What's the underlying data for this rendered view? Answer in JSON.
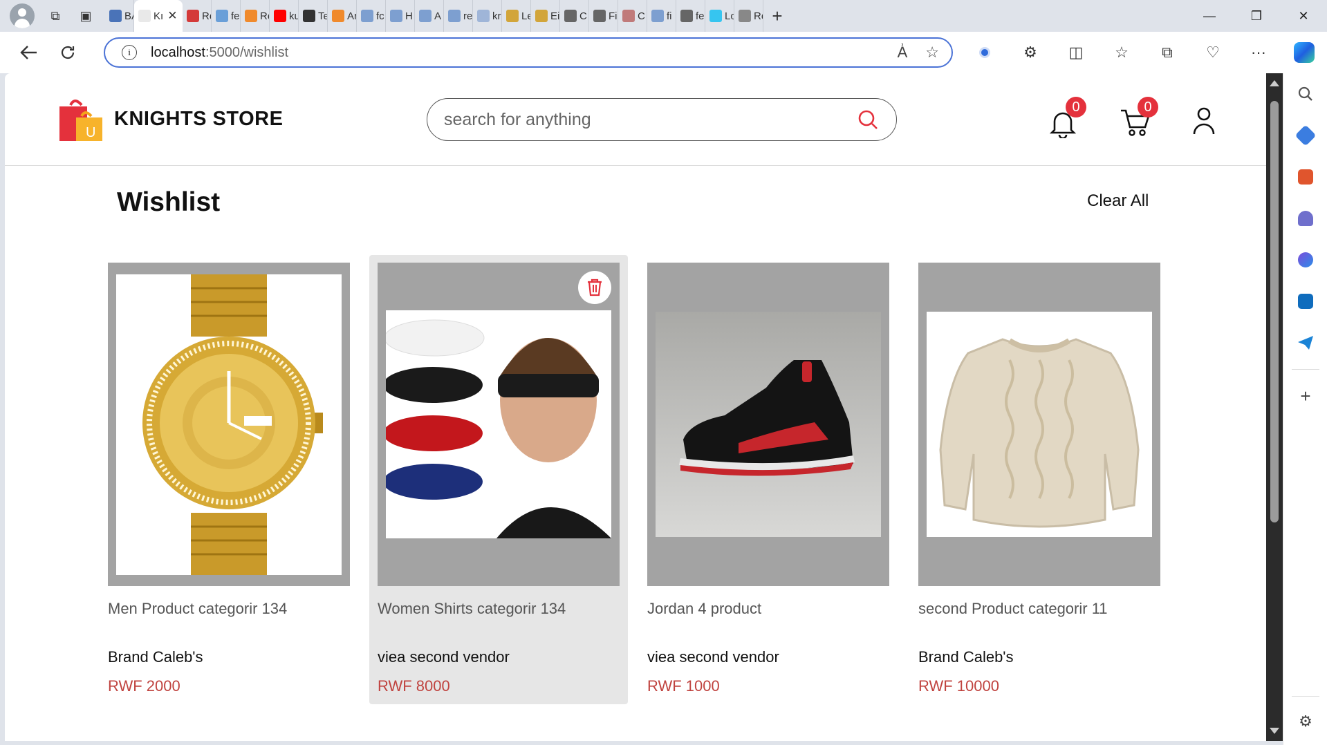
{
  "browser": {
    "tabs": [
      {
        "label": "BA",
        "color": "#4a73b8"
      },
      {
        "label": "Kı",
        "color": "#e9e9e9"
      },
      {
        "label": "Re",
        "color": "#d43a3a"
      },
      {
        "label": "fe",
        "color": "#6a9fd8"
      },
      {
        "label": "Re",
        "color": "#f08a2c"
      },
      {
        "label": "ku",
        "color": "#ff0000"
      },
      {
        "label": "Te",
        "color": "#333333"
      },
      {
        "label": "Ar",
        "color": "#f08a2c"
      },
      {
        "label": "fc",
        "color": "#7d9fd0"
      },
      {
        "label": "H",
        "color": "#7d9fd0"
      },
      {
        "label": "A",
        "color": "#7d9fd0"
      },
      {
        "label": "re",
        "color": "#7d9fd0"
      },
      {
        "label": "kr",
        "color": "#9fb5d8"
      },
      {
        "label": "Le",
        "color": "#d2a53a"
      },
      {
        "label": "Ei",
        "color": "#d2a53a"
      },
      {
        "label": "C",
        "color": "#666666"
      },
      {
        "label": "Fi",
        "color": "#666666"
      },
      {
        "label": "C",
        "color": "#c07a7a"
      },
      {
        "label": "fi",
        "color": "#7d9fd0"
      },
      {
        "label": "fe",
        "color": "#666666"
      },
      {
        "label": "Lo",
        "color": "#36c5f0"
      },
      {
        "label": "Re",
        "color": "#888888"
      }
    ],
    "active_tab_label": "Kı",
    "url_host": "localhost",
    "url_path": ":5000/wishlist"
  },
  "header": {
    "brand": "KNIGHTS STORE",
    "logo_letter": "U",
    "search_placeholder": "search for anything",
    "notification_count": "0",
    "cart_count": "0"
  },
  "wishlist": {
    "title": "Wishlist",
    "clear_all": "Clear All",
    "items": [
      {
        "name": "Men Product categorir 134",
        "vendor": "Brand Caleb's",
        "price": "RWF 2000",
        "image": "gold-wristwatch"
      },
      {
        "name": "Women Shirts categorir 134",
        "vendor": "viea second vendor",
        "price": "RWF 8000",
        "image": "sport-headbands"
      },
      {
        "name": "Jordan 4 product",
        "vendor": "viea second vendor",
        "price": "RWF 1000",
        "image": "black-red-sneaker"
      },
      {
        "name": "second Product categorir 11",
        "vendor": "Brand Caleb's",
        "price": "RWF 10000",
        "image": "cable-knit-sweater"
      }
    ]
  },
  "colors": {
    "price": "#c0433f",
    "badge": "#e4313c",
    "card_bg": "#a3a3a3",
    "search_icon": "#e4313c"
  }
}
